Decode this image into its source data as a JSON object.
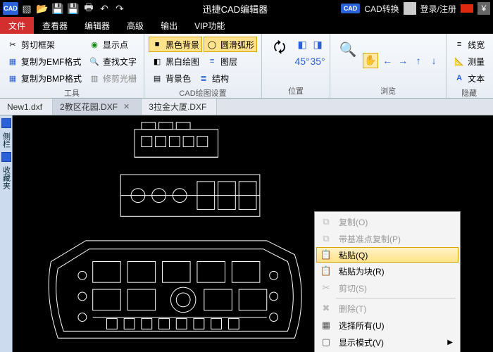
{
  "app": {
    "title": "迅捷CAD编辑器"
  },
  "titlebar_right": {
    "convert": "CAD转换",
    "login": "登录/注册"
  },
  "menu_tabs": [
    "文件",
    "查看器",
    "编辑器",
    "高级",
    "输出",
    "VIP功能"
  ],
  "menu_active": 0,
  "ribbon": {
    "tools": {
      "label": "工具",
      "items": [
        "剪切框架",
        "复制为EMF格式",
        "复制为BMP格式",
        "显示点",
        "查找文字",
        "修剪光栅"
      ]
    },
    "cad_settings": {
      "label": "CAD绘图设置",
      "r1a": "黑色背景",
      "r1b": "圆滑弧形",
      "r2a": "黑白绘图",
      "r2b": "图层",
      "r3a": "背景色",
      "r3b": "结构"
    },
    "position": {
      "label": "位置"
    },
    "browse": {
      "label": "浏览"
    },
    "hidden": {
      "label": "隐藏",
      "items": [
        "线宽",
        "测量",
        "文本"
      ]
    }
  },
  "doc_tabs": [
    "New1.dxf",
    "2教区花园.DXF",
    "3拉金大厦.DXF"
  ],
  "doc_active": 1,
  "sidebar": {
    "v1": "侧栏",
    "v2": "收藏夹"
  },
  "ctxmenu": {
    "copy": "复制(O)",
    "copy_base": "带基准点复制(P)",
    "paste": "粘贴(Q)",
    "paste_block": "粘贴为块(R)",
    "cut": "剪切(S)",
    "delete": "删除(T)",
    "select_all": "选择所有(U)",
    "display_mode": "显示模式(V)"
  }
}
